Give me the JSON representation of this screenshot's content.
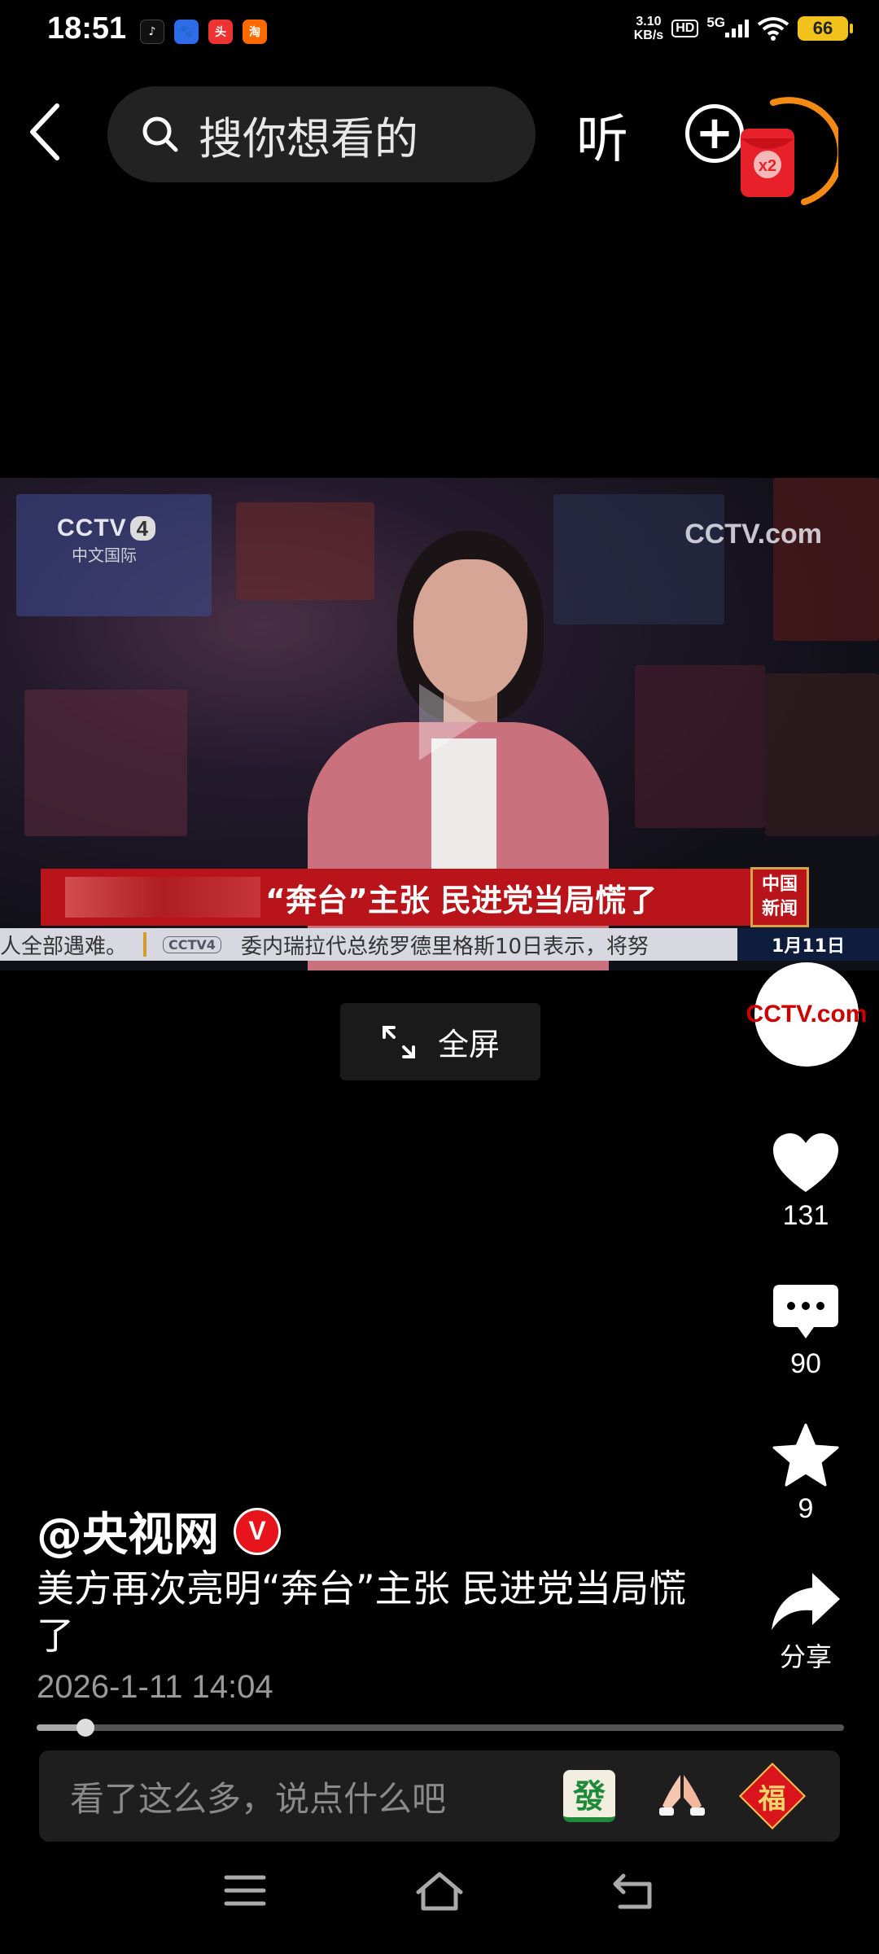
{
  "status_bar": {
    "time": "18:51",
    "apps": [
      "douyin-icon",
      "baidu-icon",
      "toutiao-icon",
      "taobao-icon"
    ],
    "speed_value": "3.10",
    "speed_unit": "KB/s",
    "hd": "HD",
    "network": "5G",
    "battery": "66"
  },
  "top_bar": {
    "search_placeholder": "搜你想看的",
    "listen_label": "听",
    "redpacket_label": "x2"
  },
  "video": {
    "channel_logo_line1": "CCTV",
    "channel_logo_number": "4",
    "channel_logo_line2": "中文国际",
    "watermark": "CCTV.com",
    "headline": "“奔台”主张 民进党当局慌了",
    "news_badge_line1": "中国",
    "news_badge_line2": "新闻",
    "ticker_left": "人全部遇难。",
    "ticker_logo": "CCTV4",
    "ticker_right": "委内瑞拉代总统罗德里格斯10日表示，将努",
    "date": "1月11日"
  },
  "fullscreen_label": "全屏",
  "rail": {
    "avatar_text": "CCTV.com",
    "likes": "131",
    "comments": "90",
    "favorites": "9",
    "share_label": "分享"
  },
  "post": {
    "author": "@央视网",
    "verified": "V",
    "description": "美方再次亮明“奔台”主张 民进党当局慌了",
    "timestamp": "2026-1-11 14:04",
    "progress": 0.06
  },
  "comment_bar": {
    "placeholder": "看了这么多，说点什么吧",
    "mahjong": "發",
    "fu": "福"
  },
  "colors": {
    "accent_red": "#e8141c",
    "battery": "#f1c21b",
    "headline_red": "#b8141a"
  }
}
